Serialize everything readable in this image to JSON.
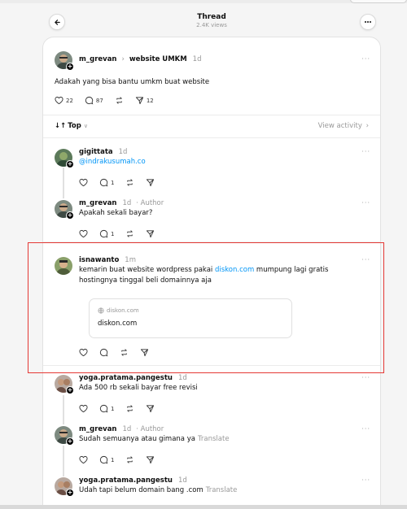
{
  "header": {
    "title": "Thread",
    "views": "2.4K views"
  },
  "main_post": {
    "username": "m_grevan",
    "community": "website UMKM",
    "time": "1d",
    "text": "Adakah yang bisa bantu umkm buat website",
    "likes": "22",
    "replies": "87",
    "shares": "12"
  },
  "sortbar": {
    "sort_label": "Top",
    "view_activity": "View activity"
  },
  "replies": [
    {
      "username": "gigittata",
      "time": "1d",
      "author": "",
      "text": "@indrakusumah.co",
      "reply_count": "1"
    },
    {
      "username": "m_grevan",
      "time": "1d",
      "author": "· Author",
      "text": "Apakah sekali bayar?",
      "reply_count": "1"
    },
    {
      "username": "isnawanto",
      "time": "1m",
      "author": "",
      "text_before": "kemarin buat website wordpress pakai ",
      "link": "diskon.com",
      "text_after": " mumpung lagi gratis hostingnya tinggal beli domainnya aja",
      "link_card": {
        "domain": "diskon.com",
        "title": "diskon.com"
      }
    },
    {
      "username": "yoga.pratama.pangestu",
      "time": "1d",
      "author": "",
      "text": "Ada 500 rb sekali bayar free revisi",
      "reply_count": "1"
    },
    {
      "username": "m_grevan",
      "time": "1d",
      "author": "· Author",
      "text": "Sudah semuanya atau gimana ya",
      "translate": "Translate",
      "reply_count": "1"
    },
    {
      "username": "yoga.pratama.pangestu",
      "time": "1d",
      "author": "",
      "text": "Udah tapi belum domain bang .com",
      "translate": "Translate"
    }
  ],
  "colors": {
    "accent_link": "#0095f6",
    "highlight_border": "#e53935"
  }
}
